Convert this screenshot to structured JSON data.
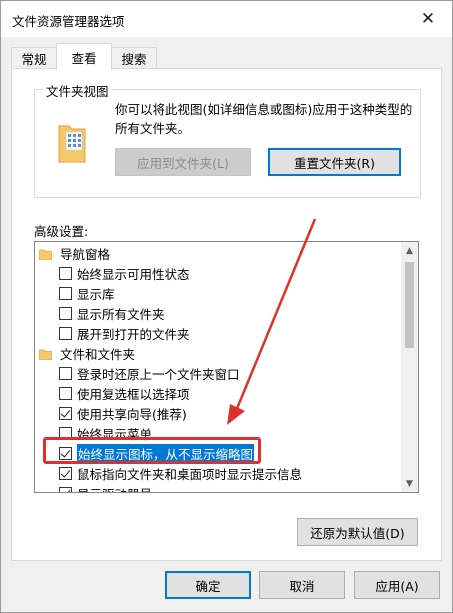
{
  "window": {
    "title": "文件资源管理器选项",
    "close_glyph": "✕"
  },
  "tabs": [
    {
      "label": "常规",
      "active": false
    },
    {
      "label": "查看",
      "active": true
    },
    {
      "label": "搜索",
      "active": false
    }
  ],
  "folder_views": {
    "legend": "文件夹视图",
    "description": "你可以将此视图(如详细信息或图标)应用于这种类型的所有文件夹。",
    "apply_button": "应用到文件夹(L)",
    "reset_button": "重置文件夹(R)"
  },
  "advanced": {
    "label": "高级设置:",
    "items": [
      {
        "type": "folder",
        "text": "导航窗格"
      },
      {
        "type": "checkbox",
        "checked": false,
        "text": "始终显示可用性状态"
      },
      {
        "type": "checkbox",
        "checked": false,
        "text": "显示库"
      },
      {
        "type": "checkbox",
        "checked": false,
        "text": "显示所有文件夹"
      },
      {
        "type": "checkbox",
        "checked": false,
        "text": "展开到打开的文件夹"
      },
      {
        "type": "folder",
        "text": "文件和文件夹"
      },
      {
        "type": "checkbox",
        "checked": false,
        "text": "登录时还原上一个文件夹窗口"
      },
      {
        "type": "checkbox",
        "checked": false,
        "text": "使用复选框以选择项"
      },
      {
        "type": "checkbox",
        "checked": true,
        "text": "使用共享向导(推荐)"
      },
      {
        "type": "checkbox",
        "checked": false,
        "text": "始终显示菜单"
      },
      {
        "type": "checkbox",
        "checked": true,
        "selected": true,
        "text": "始终显示图标，从不显示缩略图"
      },
      {
        "type": "checkbox",
        "checked": true,
        "text": "鼠标指向文件夹和桌面项时显示提示信息"
      },
      {
        "type": "checkbox",
        "checked": true,
        "text": "显示驱动器号"
      }
    ],
    "restore_defaults": "还原为默认值(D)"
  },
  "footer": {
    "ok": "确定",
    "cancel": "取消",
    "apply": "应用(A)"
  },
  "colors": {
    "selection": "#0078d7",
    "annotation": "#e0302a",
    "folder": "#f5c96b"
  }
}
